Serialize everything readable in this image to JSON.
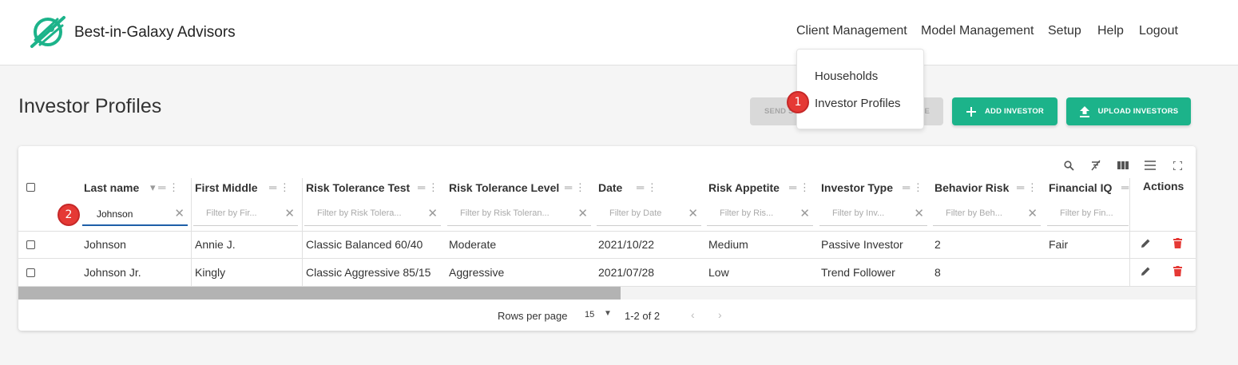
{
  "brand": {
    "name": "Best-in-Galaxy Advisors",
    "logo_icon": "planet-logo-icon",
    "color": "#1cb38a"
  },
  "nav": [
    {
      "label": "Client Management"
    },
    {
      "label": "Model Management"
    },
    {
      "label": "Setup"
    },
    {
      "label": "Help"
    },
    {
      "label": "Logout"
    }
  ],
  "dropdown": {
    "items": [
      {
        "label": "Households"
      },
      {
        "label": "Investor Profiles"
      }
    ]
  },
  "markers": {
    "m1": "1",
    "m2": "2"
  },
  "page": {
    "title": "Investor Profiles"
  },
  "buttons": {
    "send_left": "SEND S",
    "send_right": "E",
    "add_investor": "ADD INVESTOR",
    "upload_investors": "UPLOAD INVESTORS"
  },
  "grid": {
    "columns": [
      {
        "header": "Last name",
        "filter_value": "Johnson"
      },
      {
        "header": "First Middle",
        "filter_placeholder": "Filter by Fir..."
      },
      {
        "header": "Risk Tolerance Test",
        "filter_placeholder": "Filter by Risk Tolera..."
      },
      {
        "header": "Risk Tolerance Level",
        "filter_placeholder": "Filter by Risk Toleran..."
      },
      {
        "header": "Date",
        "filter_placeholder": "Filter by Date"
      },
      {
        "header": "Risk Appetite",
        "filter_placeholder": "Filter by Ris..."
      },
      {
        "header": "Investor Type",
        "filter_placeholder": "Filter by Inv..."
      },
      {
        "header": "Behavior Risk",
        "filter_placeholder": "Filter by Beh..."
      },
      {
        "header": "Financial IQ",
        "filter_placeholder": "Filter by Fin..."
      }
    ],
    "actions_header": "Actions",
    "rows": [
      [
        "Johnson",
        "Annie J.",
        "Classic Balanced 60/40",
        "Moderate",
        "2021/10/22",
        "Medium",
        "Passive Investor",
        "2",
        "Fair"
      ],
      [
        "Johnson Jr.",
        "Kingly",
        "Classic Aggressive 85/15",
        "Aggressive",
        "2021/07/28",
        "Low",
        "Trend Follower",
        "8",
        ""
      ]
    ],
    "toolbar_icons": [
      "search-icon",
      "clear-filter-icon",
      "columns-icon",
      "density-icon",
      "fullscreen-icon"
    ],
    "footer": {
      "rows_per_page_label": "Rows per page",
      "rows_per_page": "15",
      "range": "1-2 of 2"
    },
    "delete_color": "#e53935"
  }
}
